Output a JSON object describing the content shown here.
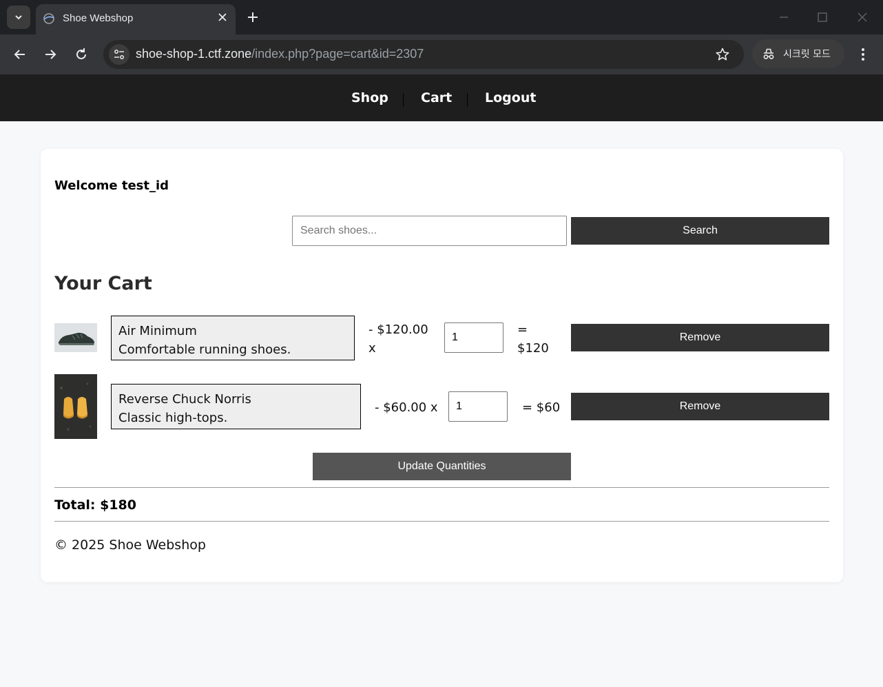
{
  "browser": {
    "tab_title": "Shoe Webshop",
    "url_host": "shoe-shop-1.ctf.zone",
    "url_path": "/index.php?page=cart&id=2307",
    "incognito_label": "시크릿 모드"
  },
  "nav": {
    "shop": "Shop",
    "cart": "Cart",
    "logout": "Logout"
  },
  "welcome": "Welcome test_id",
  "search": {
    "placeholder": "Search shoes...",
    "value": "",
    "button": "Search"
  },
  "cart": {
    "heading": "Your Cart",
    "items": [
      {
        "name": "Air Minimum",
        "description": "Comfortable running shoes.",
        "price_line1": "- $120.00",
        "price_line2": "x",
        "quantity": "1",
        "subtotal_line1": "=",
        "subtotal_line2": "$120",
        "remove": "Remove",
        "image": "shoe-dark-sneaker"
      },
      {
        "name": "Reverse Chuck Norris",
        "description": "Classic high-tops.",
        "price_line1": "- $60.00 x",
        "quantity": "1",
        "subtotal_line1": "= $60",
        "remove": "Remove",
        "image": "shoe-yellow-pair"
      }
    ],
    "update_button": "Update Quantities",
    "total": "Total: $180"
  },
  "footer": "© 2025 Shoe Webshop",
  "colors": {
    "nav_bg": "#1e1e1e",
    "button_dark": "#333333",
    "button_update": "#555555",
    "page_bg": "#f7f8fa"
  }
}
